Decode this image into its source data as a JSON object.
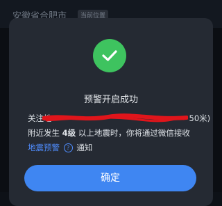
{
  "background": {
    "header_title": "安徽省合肥市",
    "header_tag": "当前位置"
  },
  "dialog": {
    "title": "预警开启成功",
    "line1_prefix": "关注地",
    "line1_suffix": "50米)",
    "line2_prefix": "附近发生",
    "magnitude": "4级",
    "line2_suffix": "以上地震时，你将通过微信接收",
    "link_label": "地震预警",
    "help_icon_glyph": "?",
    "line3_suffix": "通知",
    "confirm_label": "确定"
  },
  "colors": {
    "accent": "#3f86f2",
    "success": "#3ec35f",
    "redaction": "#e0151b",
    "link": "#4f8dff"
  }
}
